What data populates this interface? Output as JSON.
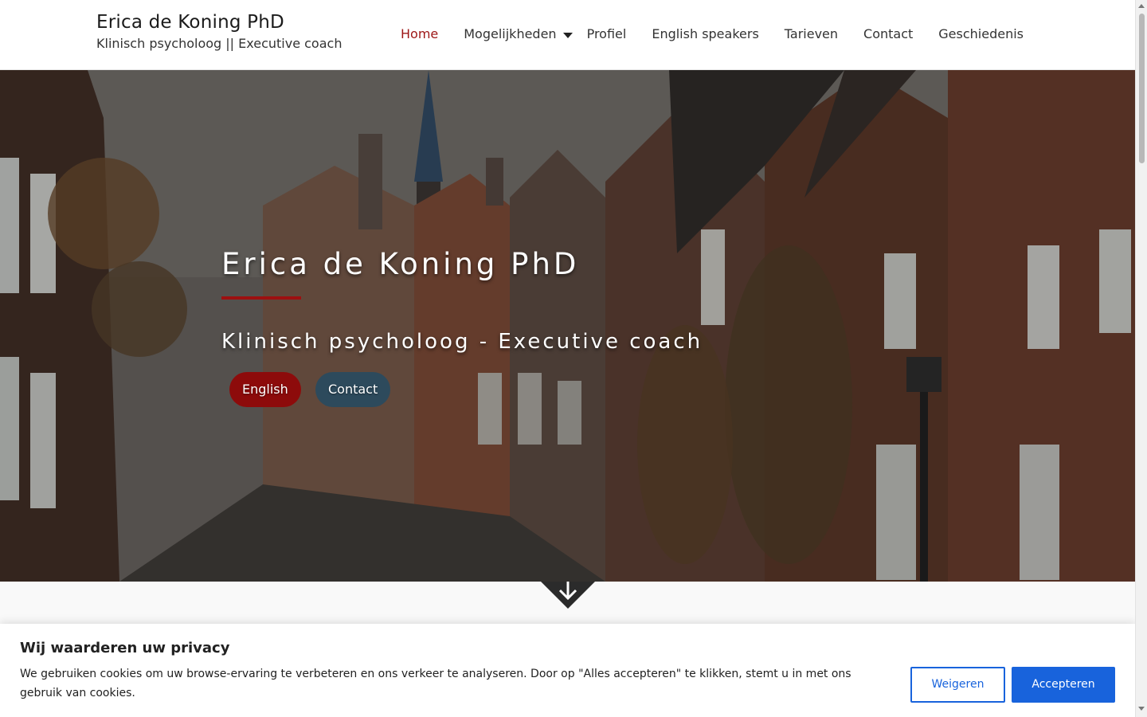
{
  "header": {
    "brand_title": "Erica de Koning PhD",
    "brand_subtitle": "Klinisch psycholoog || Executive coach",
    "nav": [
      {
        "label": "Home",
        "active": true
      },
      {
        "label": "Mogelijkheden",
        "has_dropdown": true
      },
      {
        "label": "Profiel"
      },
      {
        "label": "English speakers"
      },
      {
        "label": "Tarieven"
      },
      {
        "label": "Contact"
      },
      {
        "label": "Geschiedenis"
      }
    ]
  },
  "hero": {
    "title": "Erica de Koning PhD",
    "subtitle": "Klinisch psycholoog - Executive coach",
    "buttons": {
      "english": "English",
      "contact": "Contact"
    },
    "scroll_icon": "arrow-down-icon"
  },
  "cookie_banner": {
    "title": "Wij waarderen uw privacy",
    "text": "We gebruiken cookies om uw browse-ervaring te verbeteren en ons verkeer te analyseren. Door op \"Alles accepteren\" te klikken, stemt u in met ons gebruik van cookies.",
    "reject_label": "Weigeren",
    "accept_label": "Accepteren"
  },
  "colors": {
    "accent_red": "#9d1616",
    "hero_button_red": "#8d0b0b",
    "hero_button_blue": "#2d4a5c",
    "cookie_blue": "#1863dc"
  }
}
